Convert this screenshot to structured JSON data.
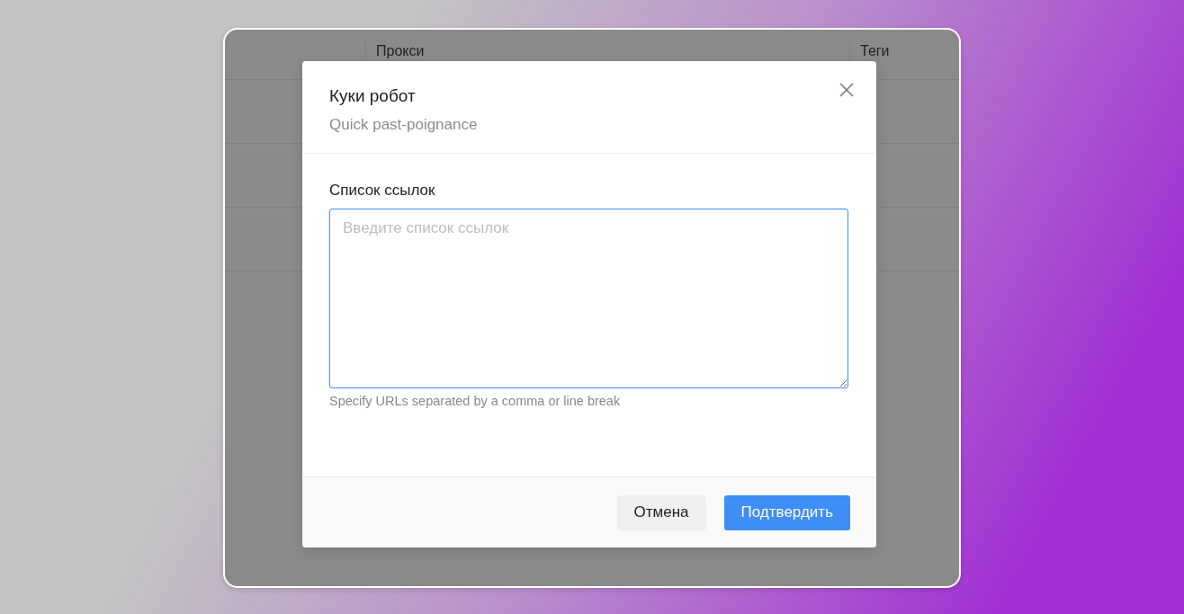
{
  "table": {
    "columns": [
      {
        "label": "Прокси"
      },
      {
        "label": "Теги"
      }
    ]
  },
  "dialog": {
    "title": "Куки робот",
    "subtitle": "Quick past-poignance",
    "field": {
      "label": "Список ссылок",
      "placeholder": "Введите список ссылок",
      "hint": "Specify URLs separated by a comma or line break"
    },
    "buttons": [
      {
        "label": "Отмена",
        "kind": "secondary"
      },
      {
        "label": "Подтвердить",
        "kind": "primary"
      }
    ]
  }
}
